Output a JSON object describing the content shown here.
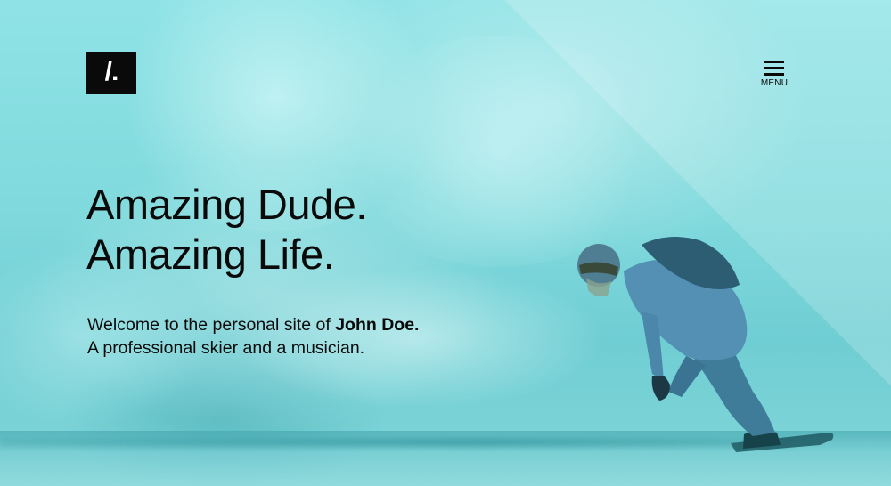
{
  "logo": {
    "mark": "/."
  },
  "menu": {
    "label": "MENU",
    "icon": "hamburger-icon"
  },
  "hero": {
    "headline_line1": "Amazing Dude.",
    "headline_line2": "Amazing Life.",
    "intro_prefix": "Welcome to the personal site of ",
    "intro_name": "John Doe.",
    "intro_line2": "A professional skier and a musician."
  },
  "colors": {
    "background": "#7fd9dc",
    "text": "#0a0a0a",
    "logo_bg": "#0a0a0a",
    "logo_fg": "#ffffff"
  }
}
